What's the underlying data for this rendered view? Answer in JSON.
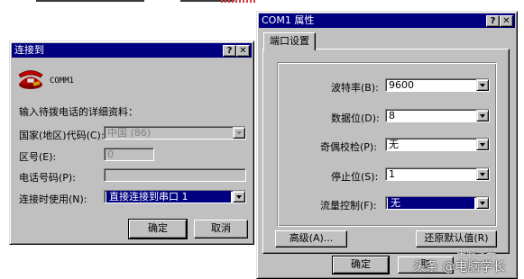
{
  "connect_dialog": {
    "title": "连接到",
    "help_btn": "?",
    "close_btn": "✕",
    "connection_name": "COMM1",
    "prompt": "输入待拨电话的详细资料：",
    "country_label": "国家(地区)代码(C):",
    "country_value": "中国 (86)",
    "area_label": "区号(E):",
    "area_value": "0",
    "phone_label": "电话号码(P):",
    "phone_value": "",
    "connect_using_label": "连接时使用(N):",
    "connect_using_value": "直接连接到串口 1",
    "ok_label": "确定",
    "cancel_label": "取消"
  },
  "properties_dialog": {
    "title": "COM1 属性",
    "help_btn": "?",
    "close_btn": "✕",
    "tab_label": "端口设置",
    "baud_label": "波特率(B):",
    "baud_value": "9600",
    "databits_label": "数据位(D):",
    "databits_value": "8",
    "parity_label": "奇偶校检(P):",
    "parity_value": "无",
    "stopbits_label": "停止位(S):",
    "stopbits_value": "1",
    "flow_label": "流量控制(F):",
    "flow_value": "无",
    "advanced_label": "高级(A)...",
    "restore_label": "还原默认值(R)",
    "ok_label": "确定",
    "cancel_label": "取"
  },
  "watermark": {
    "text": "头条 @电脑学长",
    "text_small": "电脑学长"
  },
  "colors": {
    "face": "#c0c0c0",
    "titlebar": "#000080",
    "selection": "#000080"
  }
}
